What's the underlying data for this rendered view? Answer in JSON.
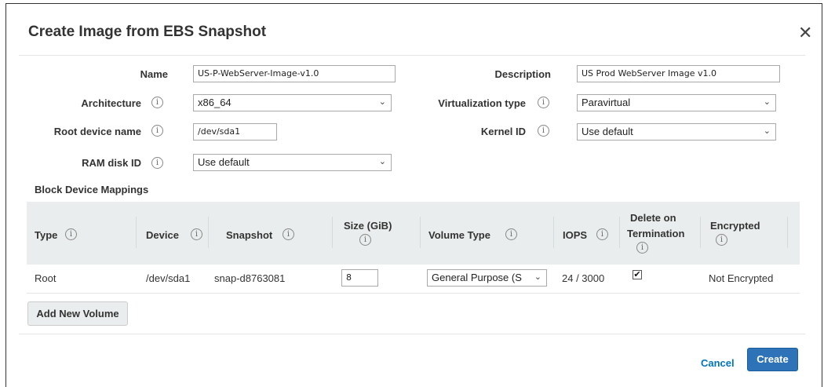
{
  "dialog": {
    "title": "Create Image from EBS Snapshot",
    "close_glyph": "✕"
  },
  "form": {
    "name_label": "Name",
    "name_value": "US-P-WebServer-Image-v1.0",
    "description_label": "Description",
    "description_value": "US Prod WebServer Image v1.0",
    "architecture_label": "Architecture",
    "architecture_value": "x86_64",
    "virtualization_label": "Virtualization type",
    "virtualization_value": "Paravirtual",
    "root_device_label": "Root device name",
    "root_device_value": "/dev/sda1",
    "kernel_label": "Kernel ID",
    "kernel_value": "Use default",
    "ramdisk_label": "RAM disk ID",
    "ramdisk_value": "Use default"
  },
  "info_glyph": "i",
  "chevron_glyph": "⌄",
  "block_device": {
    "section_title": "Block Device Mappings",
    "columns": {
      "type": "Type",
      "device": "Device",
      "snapshot": "Snapshot",
      "size_line1": "Size (GiB)",
      "volume_type": "Volume Type",
      "iops": "IOPS",
      "delete_line1": "Delete on",
      "delete_line2": "Termination",
      "encrypted": "Encrypted"
    },
    "row": {
      "type": "Root",
      "device": "/dev/sda1",
      "snapshot": "snap-d8763081",
      "size": "8",
      "volume_type": "General Purpose (S",
      "iops": "24 / 3000",
      "delete_on_termination": true,
      "check_glyph": "✔",
      "encrypted": "Not Encrypted"
    },
    "add_button": "Add New Volume"
  },
  "footer": {
    "cancel": "Cancel",
    "create": "Create"
  },
  "colors": {
    "primary_button": "#2e73b8",
    "link": "#0073bb",
    "table_header_bg": "#eaeded"
  }
}
